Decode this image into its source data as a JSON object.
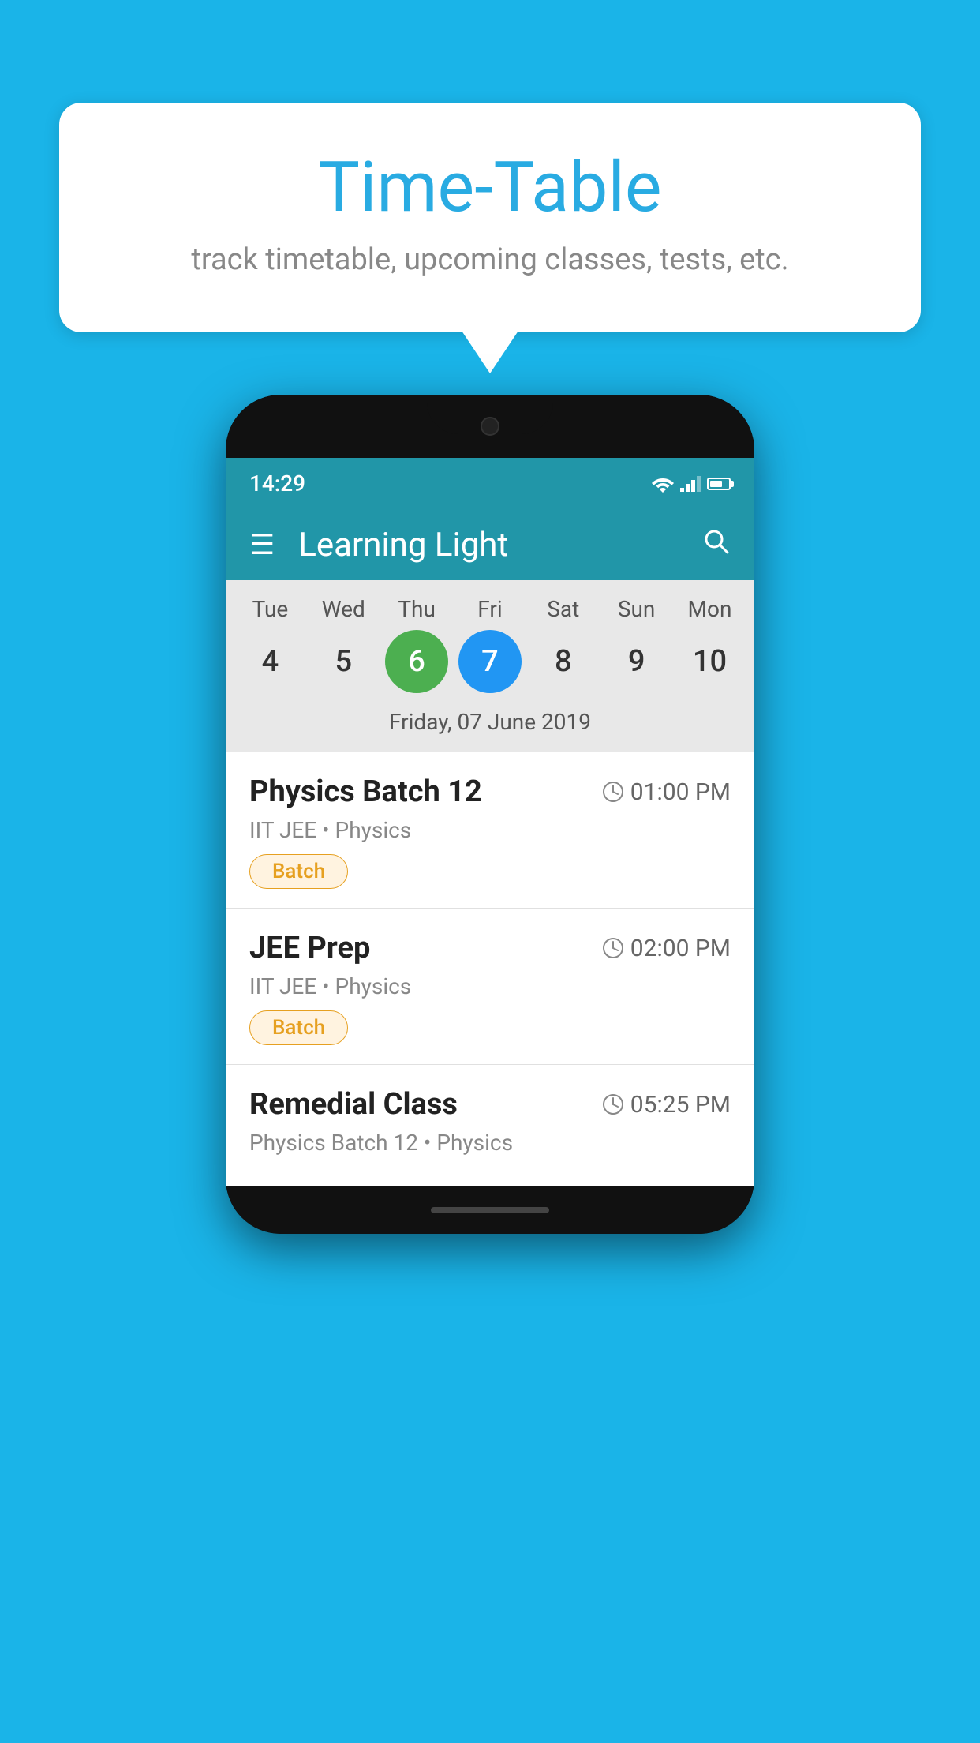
{
  "page": {
    "background_color": "#1ab4e8"
  },
  "bubble": {
    "title": "Time-Table",
    "subtitle": "track timetable, upcoming classes, tests, etc."
  },
  "phone": {
    "status_bar": {
      "time": "14:29"
    },
    "header": {
      "app_name": "Learning Light",
      "menu_icon": "☰",
      "search_icon": "🔍"
    },
    "calendar": {
      "days": [
        "Tue",
        "Wed",
        "Thu",
        "Fri",
        "Sat",
        "Sun",
        "Mon"
      ],
      "numbers": [
        4,
        5,
        6,
        7,
        8,
        9,
        10
      ],
      "today_index": 2,
      "selected_index": 3,
      "date_label": "Friday, 07 June 2019"
    },
    "schedule": [
      {
        "title": "Physics Batch 12",
        "time": "01:00 PM",
        "subtitle": "IIT JEE • Physics",
        "badge": "Batch"
      },
      {
        "title": "JEE Prep",
        "time": "02:00 PM",
        "subtitle": "IIT JEE • Physics",
        "badge": "Batch"
      },
      {
        "title": "Remedial Class",
        "time": "05:25 PM",
        "subtitle": "Physics Batch 12 • Physics",
        "badge": ""
      }
    ]
  }
}
